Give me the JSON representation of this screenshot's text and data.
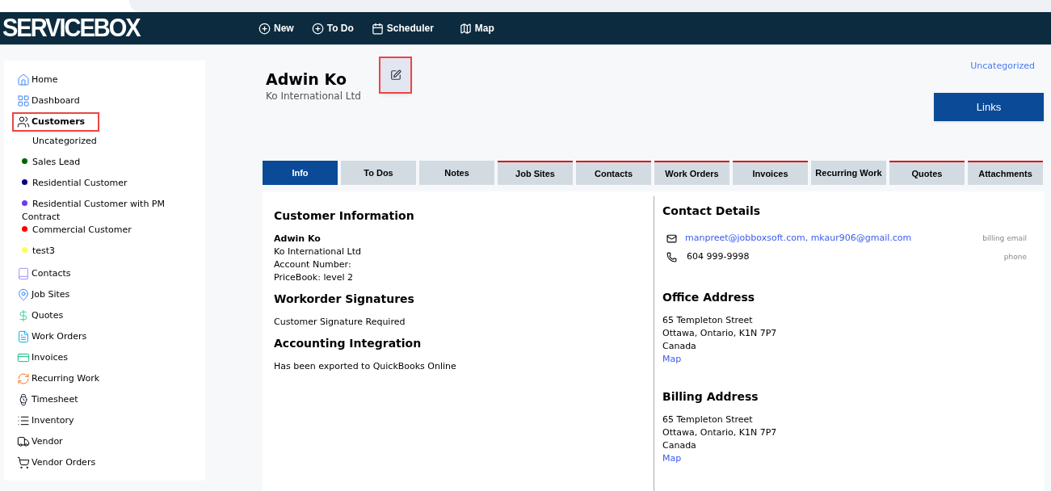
{
  "brand": "SERVICEBOX",
  "top_nav": [
    {
      "label": "New"
    },
    {
      "label": "To Do"
    },
    {
      "label": "Scheduler"
    },
    {
      "label": "Map"
    }
  ],
  "sidebar": {
    "items": [
      {
        "label": "Home",
        "selected": false,
        "highlighted": false
      },
      {
        "label": "Dashboard",
        "selected": false,
        "highlighted": false
      },
      {
        "label": "Customers",
        "selected": true,
        "highlighted": true,
        "children": [
          {
            "label": "Uncategorized"
          },
          {
            "label": "Sales Lead",
            "color": "#006400"
          },
          {
            "label": "Residential Customer",
            "color": "#00008b"
          },
          {
            "label": "Residential Customer with PM Contract",
            "color": "#6a3cf5"
          },
          {
            "label": "Commercial Customer",
            "color": "#ff0000"
          },
          {
            "label": "test3",
            "color": "#ffff55"
          }
        ]
      },
      {
        "label": "Contacts",
        "selected": false,
        "highlighted": false
      },
      {
        "label": "Job Sites",
        "selected": false,
        "highlighted": false
      },
      {
        "label": "Quotes",
        "selected": false,
        "highlighted": false
      },
      {
        "label": "Work Orders",
        "selected": false,
        "highlighted": false
      },
      {
        "label": "Invoices",
        "selected": false,
        "highlighted": false
      },
      {
        "label": "Recurring Work",
        "selected": false,
        "highlighted": false
      },
      {
        "label": "Timesheet",
        "selected": false,
        "highlighted": false
      },
      {
        "label": "Inventory",
        "selected": false,
        "highlighted": false
      },
      {
        "label": "Vendor",
        "selected": false,
        "highlighted": false
      },
      {
        "label": "Vendor Orders",
        "selected": false,
        "highlighted": false
      }
    ]
  },
  "customer": {
    "name": "Adwin Ko",
    "company": "Ko International Ltd",
    "category": "Uncategorized",
    "edit_button": {
      "highlighted": true
    }
  },
  "links_button": "Links",
  "tabs": [
    {
      "label": "Info",
      "selected": true,
      "marked": false
    },
    {
      "label": "To Dos",
      "selected": false,
      "marked": false
    },
    {
      "label": "Notes",
      "selected": false,
      "marked": false
    },
    {
      "label": "Job Sites",
      "selected": false,
      "marked": true
    },
    {
      "label": "Contacts",
      "selected": false,
      "marked": true
    },
    {
      "label": "Work Orders",
      "selected": false,
      "marked": true
    },
    {
      "label": "Invoices",
      "selected": false,
      "marked": true
    },
    {
      "label": "Recurring Work",
      "selected": false,
      "marked": false
    },
    {
      "label": "Quotes",
      "selected": false,
      "marked": true
    },
    {
      "label": "Attachments",
      "selected": false,
      "marked": true
    }
  ],
  "left_sections": [
    {
      "title": "Customer Information",
      "lines": [
        {
          "text": "Adwin Ko",
          "bold": true
        },
        {
          "text": "Ko International Ltd",
          "bold": false
        },
        {
          "text": "Account Number:",
          "bold": false
        },
        {
          "text": "PriceBook: level 2",
          "bold": false
        }
      ]
    },
    {
      "title": "Workorder Signatures",
      "lines": [
        {
          "text": "Customer Signature Required",
          "bold": false
        }
      ]
    },
    {
      "title": "Accounting Integration",
      "lines": [
        {
          "text": "Has been exported to QuickBooks Online",
          "bold": false
        }
      ]
    }
  ],
  "contact_details": {
    "title": "Contact Details",
    "rows": [
      {
        "kind": "email",
        "value": "manpreet@jobboxsoft.com, mkaur906@gmail.com",
        "label": "billing email"
      },
      {
        "kind": "phone",
        "value": "604 999-9998",
        "label": "phone"
      }
    ]
  },
  "addresses": [
    {
      "title": "Office Address",
      "lines": [
        "65 Templeton Street",
        "Ottawa, Ontario, K1N 7P7",
        "Canada"
      ],
      "map_link": "Map"
    },
    {
      "title": "Billing Address",
      "lines": [
        "65 Templeton Street",
        "Ottawa, Ontario, K1N 7P7",
        "Canada"
      ],
      "map_link": "Map"
    }
  ]
}
